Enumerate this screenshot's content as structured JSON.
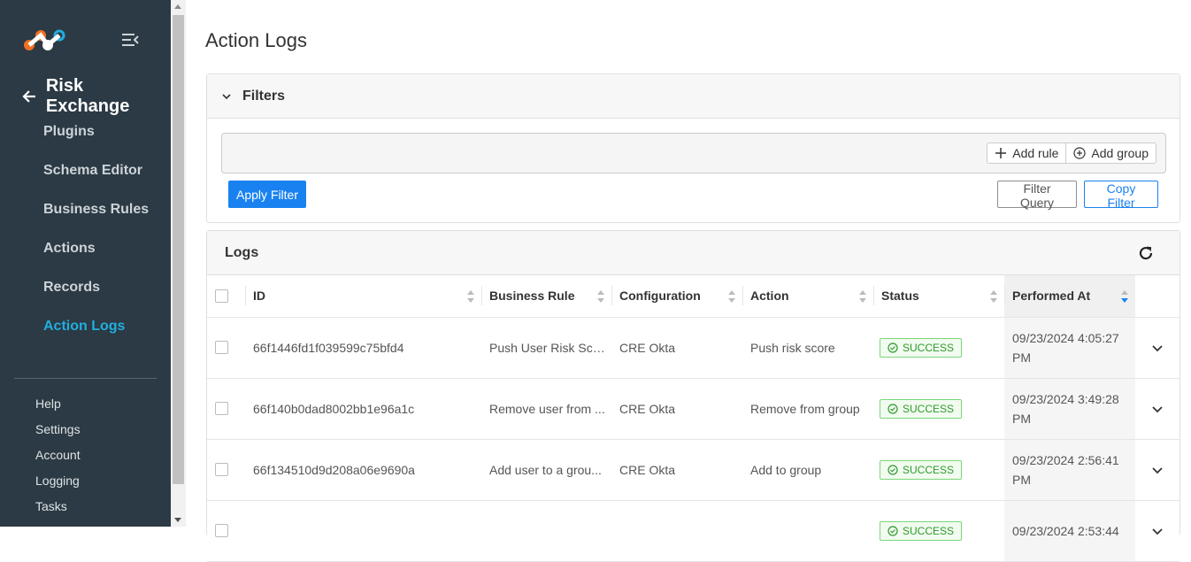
{
  "sidebar": {
    "module_title": "Risk Exchange",
    "items": [
      {
        "label": "Plugins"
      },
      {
        "label": "Schema Editor"
      },
      {
        "label": "Business Rules"
      },
      {
        "label": "Actions"
      },
      {
        "label": "Records"
      },
      {
        "label": "Action Logs"
      }
    ],
    "active_item": "Action Logs",
    "bottom_items": [
      {
        "label": "Help"
      },
      {
        "label": "Settings"
      },
      {
        "label": "Account"
      },
      {
        "label": "Logging"
      },
      {
        "label": "Tasks"
      }
    ]
  },
  "page": {
    "title": "Action Logs"
  },
  "filters": {
    "header": "Filters",
    "add_rule_label": "Add rule",
    "add_group_label": "Add group",
    "apply_label": "Apply Filter",
    "filter_query_label": "Filter Query",
    "copy_filter_label": "Copy Filter"
  },
  "logs": {
    "header": "Logs",
    "columns": {
      "id": "ID",
      "business_rule": "Business Rule",
      "configuration": "Configuration",
      "action": "Action",
      "status": "Status",
      "performed_at": "Performed At"
    },
    "sorted_column": "performed_at",
    "sort_direction": "desc",
    "rows": [
      {
        "id": "66f1446fd1f039599c75bfd4",
        "business_rule": "Push User Risk Scor...",
        "configuration": "CRE Okta",
        "action": "Push risk score",
        "status": "SUCCESS",
        "performed_at_line1": "09/23/2024 4:05:27",
        "performed_at_line2": "PM"
      },
      {
        "id": "66f140b0dad8002bb1e96a1c",
        "business_rule": "Remove user from ...",
        "configuration": "CRE Okta",
        "action": "Remove from group",
        "status": "SUCCESS",
        "performed_at_line1": "09/23/2024 3:49:28",
        "performed_at_line2": "PM"
      },
      {
        "id": "66f134510d9d208a06e9690a",
        "business_rule": "Add user to a grou...",
        "configuration": "CRE Okta",
        "action": "Add to group",
        "status": "SUCCESS",
        "performed_at_line1": "09/23/2024 2:56:41",
        "performed_at_line2": "PM"
      },
      {
        "id": "",
        "business_rule": "",
        "configuration": "",
        "action": "",
        "status": "SUCCESS",
        "performed_at_line1": "09/23/2024 2:53:44",
        "performed_at_line2": ""
      }
    ]
  },
  "colors": {
    "sidebar_bg": "#2b3a44",
    "active_nav": "#22aee0",
    "primary": "#1a82f0",
    "success": "#2f9a2f"
  }
}
